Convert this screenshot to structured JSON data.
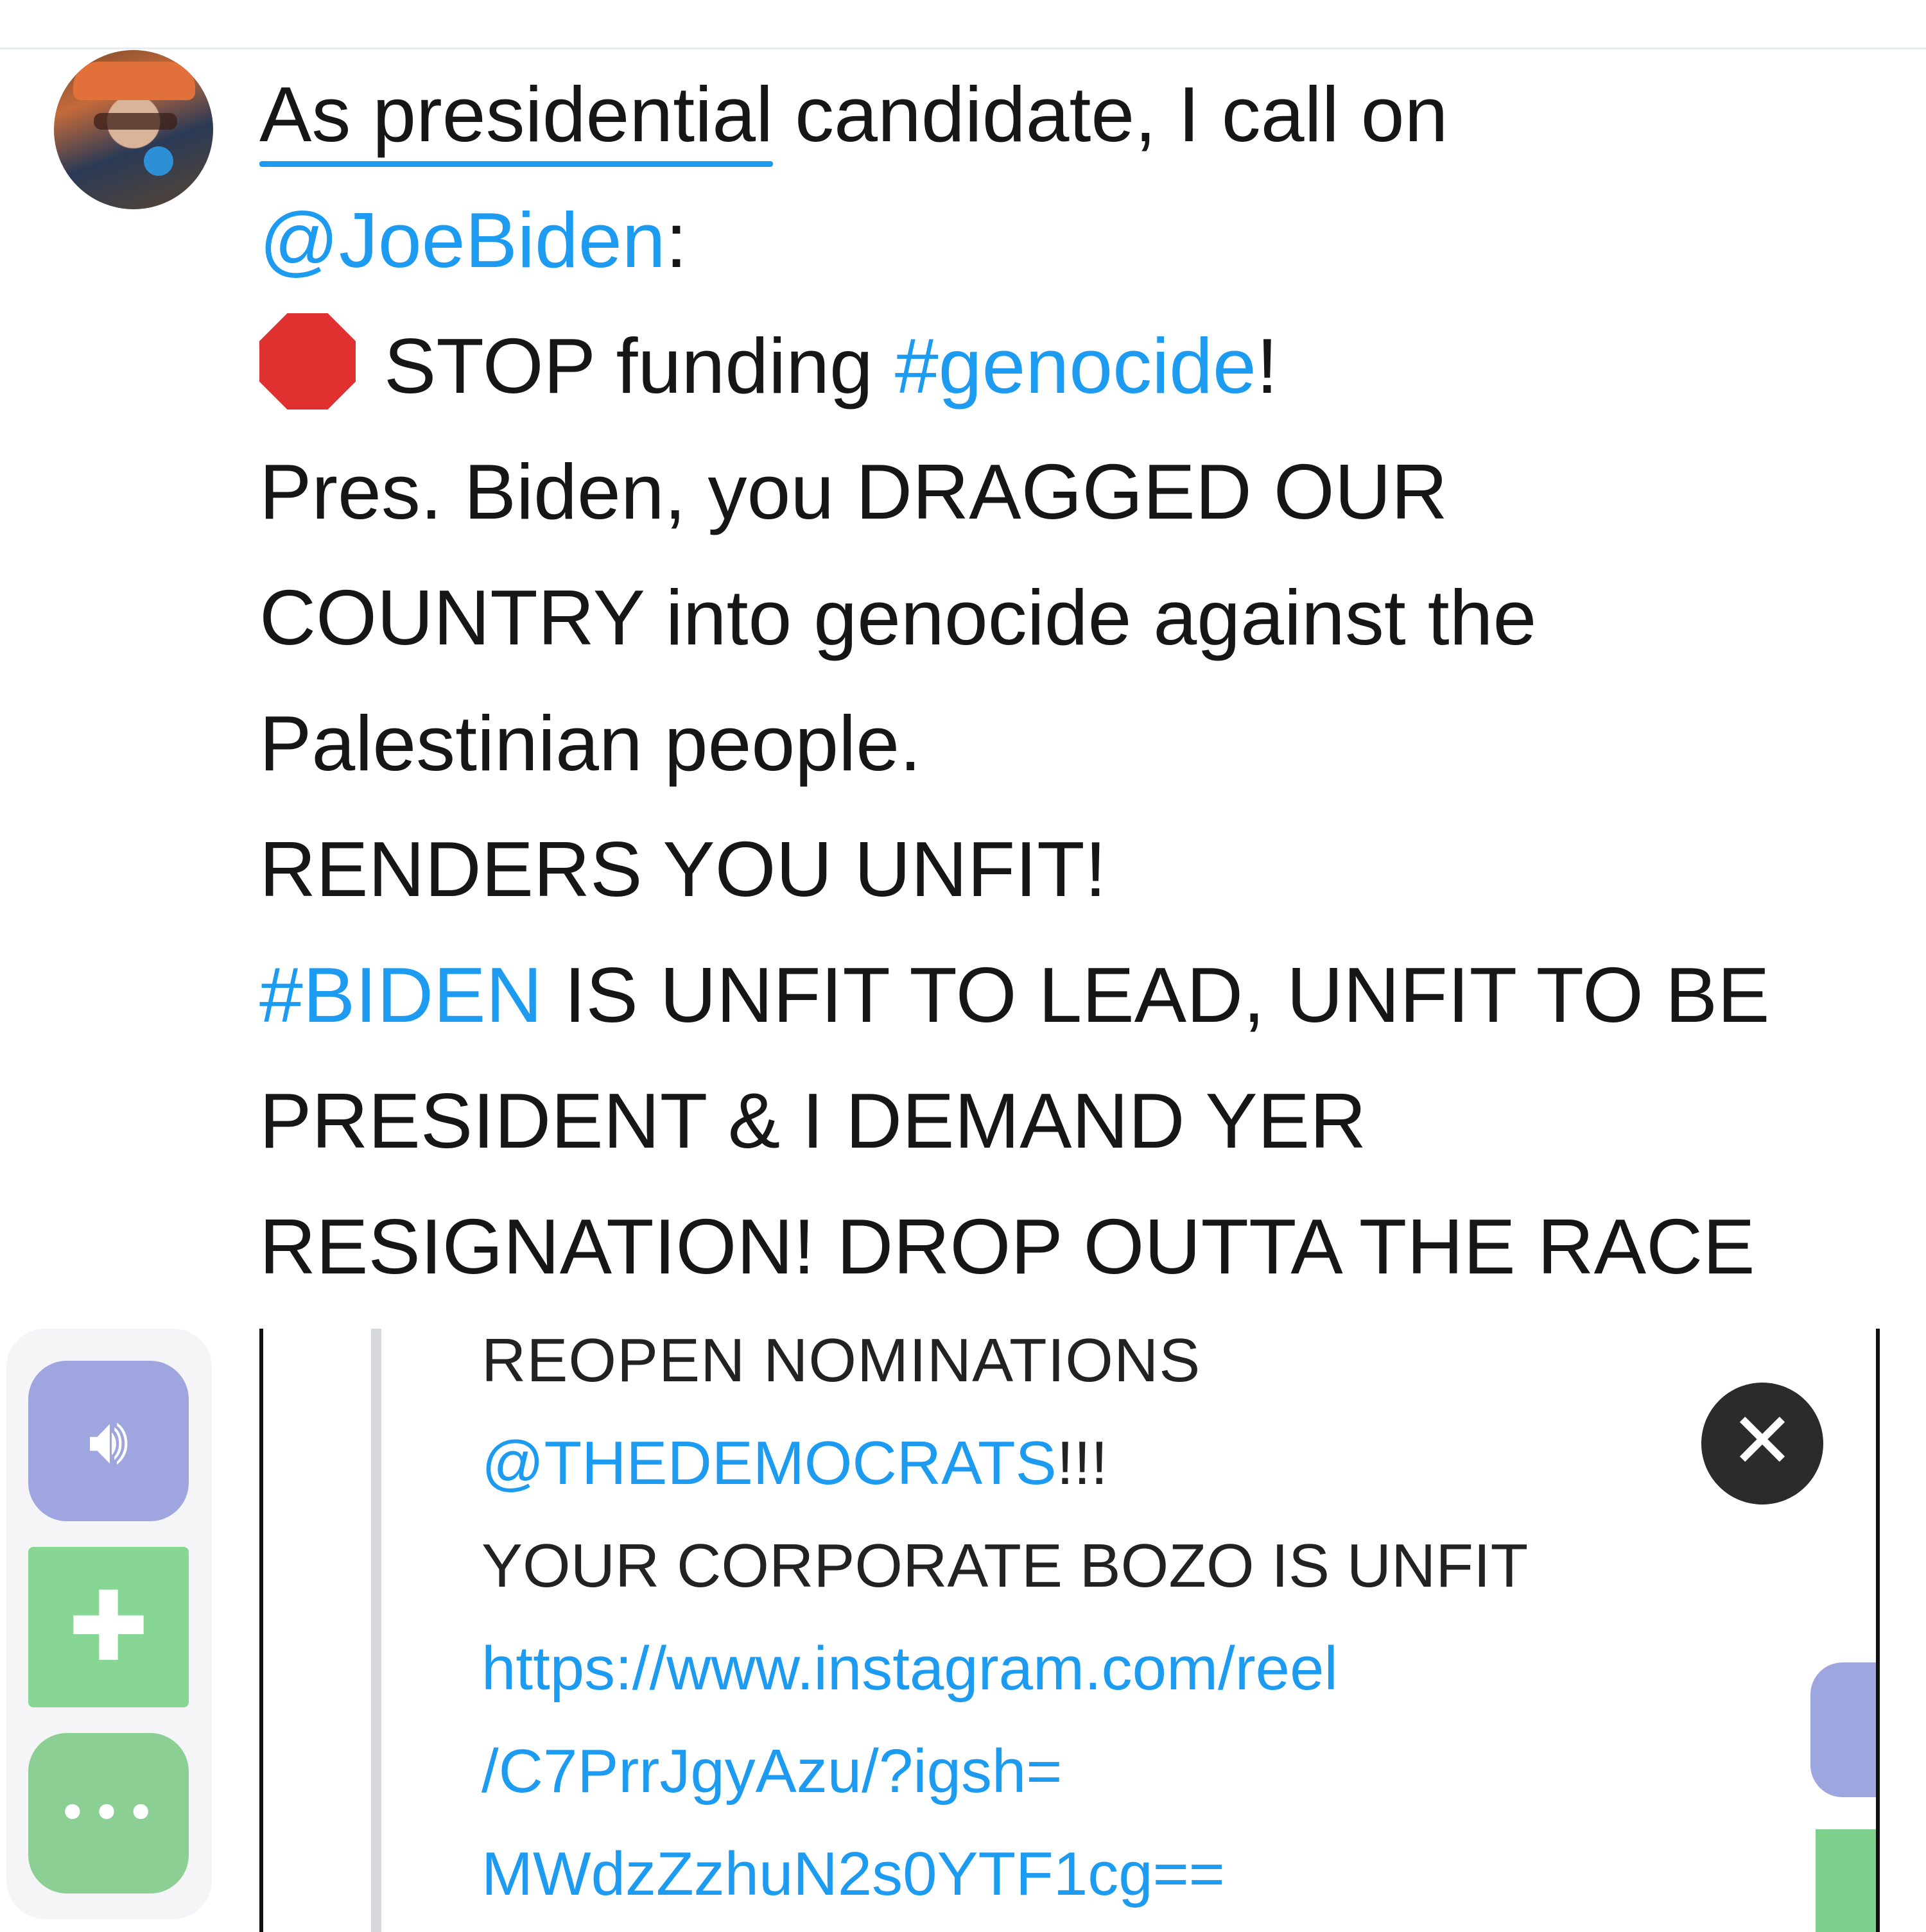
{
  "tweet": {
    "line1_underlined": "As presidential",
    "line1_rest": " candidate, I call on",
    "mention": "@JoeBiden",
    "mention_suffix": ":",
    "stop_prefix": "STOP funding ",
    "hashtag_genocide": "#genocide",
    "stop_suffix": "!",
    "line4": "Pres. Biden, you DRAGGED OUR",
    "line5": "COUNTRY into genocide against the",
    "line6": "Palestinian people.",
    "line7": "RENDERS YOU UNFIT!",
    "hashtag_biden": "#BIDEN",
    "line8_rest": " IS UNFIT TO LEAD, UNFIT TO BE",
    "line9": "PRESIDENT & I DEMAND YER",
    "line10": "RESIGNATION! DROP OUTTA THE RACE"
  },
  "embed": {
    "cut_line": "REOPEN NOMINATIONS",
    "mention": "@THEDEMOCRATS",
    "mention_suffix": "!!!",
    "line3": "YOUR CORPORATE BOZO IS UNFIT",
    "url_1": "https://www.instagram.com/reel",
    "url_2": "/C7PrrJgyAzu/?igsh=",
    "url_3": "MWdzZzhuN2s0YTF1cg==",
    "close_icon": "close-icon"
  },
  "side_tools": {
    "audio_icon": "speaker-icon",
    "extension_icon": "puzzle-icon",
    "more_label": "•••"
  },
  "colors": {
    "link": "#1d9bf0",
    "text": "#161616",
    "stop_sign": "#e03131"
  }
}
